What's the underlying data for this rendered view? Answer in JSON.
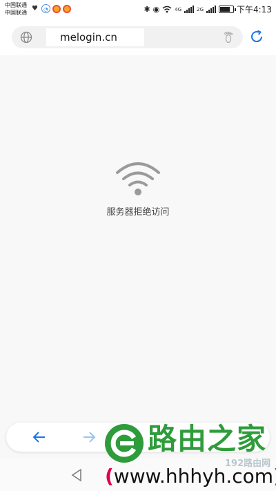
{
  "status_bar": {
    "carrier_1": "中国联通",
    "carrier_2": "中国联通",
    "net_1": "4G",
    "net_2": "2G",
    "time": "下午4:13"
  },
  "address_bar": {
    "url": "melogin.cn"
  },
  "error": {
    "message": "服务器拒绝访问"
  },
  "watermark": {
    "title": "路由之家",
    "mini": "192路由网",
    "url_open": "(",
    "url": "www.hhhyh.com",
    "url_close": ")",
    "brand_color": "#2e9c3b"
  },
  "icons": {
    "globe": "globe-icon",
    "footprint": "footprint-icon",
    "refresh": "refresh-icon",
    "wifi": "wifi-icon",
    "back": "arrow-left-icon",
    "forward": "arrow-right-icon",
    "system_back": "triangle-back-icon"
  },
  "colors": {
    "accent": "#1a73e8",
    "url_paren": "#e0004a"
  }
}
